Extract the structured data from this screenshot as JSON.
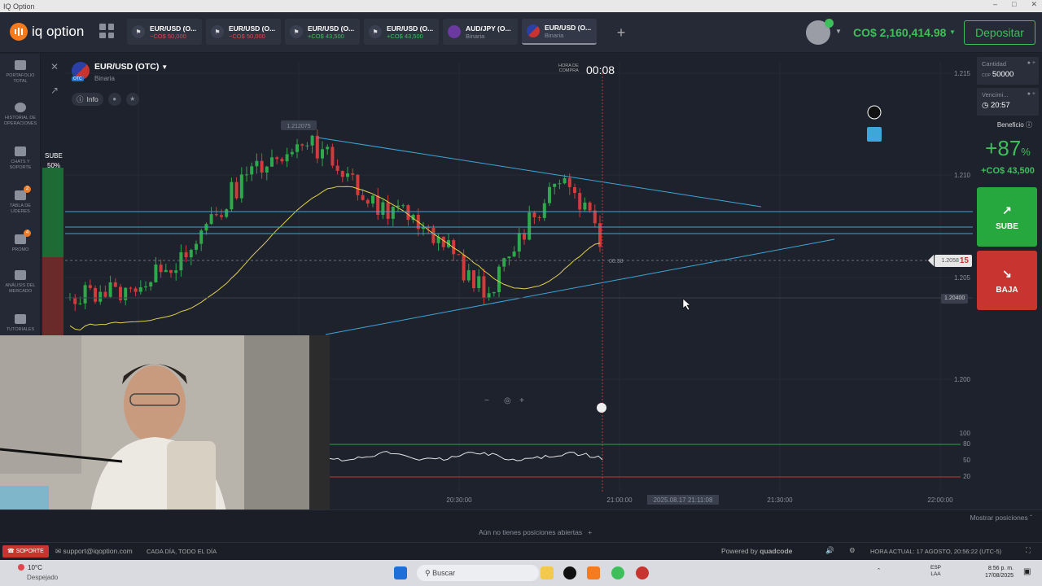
{
  "window": {
    "title": "IQ Option"
  },
  "topbar": {
    "logo_text": "iq option",
    "tabs": [
      {
        "pair": "EUR/USD (O...",
        "sub": "−CO$ 50,000",
        "sub_type": "neg"
      },
      {
        "pair": "EUR/USD (O...",
        "sub": "−CO$ 50,000",
        "sub_type": "neg"
      },
      {
        "pair": "EUR/USD (O...",
        "sub": "+CO$ 43,500",
        "sub_type": "pos"
      },
      {
        "pair": "EUR/USD (O...",
        "sub": "+CO$ 43,500",
        "sub_type": "pos"
      },
      {
        "pair": "AUD/JPY (O...",
        "sub": "Binaria",
        "sub_type": "mut"
      },
      {
        "pair": "EUR/USD (O...",
        "sub": "Binaria",
        "sub_type": "mut"
      }
    ],
    "add_tab": "+",
    "balance": "CO$ 2,160,414.98",
    "deposit_label": "Depositar"
  },
  "sidebar": {
    "items": [
      {
        "label": "PORTAFOLIO TOTAL"
      },
      {
        "label": "HISTORIAL DE OPERACIONES"
      },
      {
        "label": "CHATS Y SOPORTE"
      },
      {
        "label": "TABLA DE LÍDERES",
        "badge": "2"
      },
      {
        "label": "PROMO",
        "badge": "4"
      },
      {
        "label": "ANÁLISIS DEL MERCADO"
      },
      {
        "label": "TUTORIALES"
      }
    ]
  },
  "asset": {
    "name": "EUR/USD (OTC)",
    "type": "Binaria",
    "otc_badge": "OTC",
    "info_label": "Info"
  },
  "timer": {
    "hora_label_1": "HORA DE",
    "hora_label_2": "COMPRA",
    "value": "00:08"
  },
  "sentiment": {
    "label": "SUBE",
    "value": "50%"
  },
  "chart": {
    "price_labels": [
      "1.215",
      "1.210",
      "1.205",
      "1.200"
    ],
    "oscillator_labels": [
      "100",
      "80",
      "50",
      "20"
    ],
    "time_labels": [
      "20:30:00",
      "21:00:00",
      "21:30:00",
      "22:00:00"
    ],
    "cursor_time": "2025.08.17 21:11:08",
    "high_label": "1.212075",
    "countdown_label": "00:38",
    "current_price_prefix": "1.2058",
    "current_price_suffix": "15",
    "alert_price": "1.20400",
    "zoom_minus": "−",
    "zoom_plus": "+"
  },
  "right_panel": {
    "amount_label": "Cantidad",
    "amount_currency": "COP",
    "amount_value": "50000",
    "expiry_label": "Vencimi...",
    "expiry_value": "20:57",
    "profit_label": "Beneficio",
    "profit_pct": "+87",
    "profit_pct_sign": "%",
    "profit_amount": "+CO$ 43,500",
    "up_label": "SUBE",
    "down_label": "BAJA"
  },
  "bottom": {
    "no_positions": "Aún no tienes posiciones abiertas",
    "show_positions": "Mostrar posiciones"
  },
  "footer": {
    "support_btn": "SOPORTE",
    "email": "support@iqoption.com",
    "hours": "CADA DÍA, TODO EL DÍA",
    "powered": "Powered by",
    "powered_brand": "quadcode",
    "current_time": "HORA ACTUAL: 17 AGOSTO, 20:56:22 (UTC-5)"
  },
  "taskbar": {
    "weather_temp": "10°C",
    "weather_desc": "Despejado",
    "search_placeholder": "Buscar",
    "lang_1": "ESP",
    "lang_2": "LAA",
    "clock_time": "8:56 p. m.",
    "clock_date": "17/08/2025"
  },
  "colors": {
    "up": "#27a83e",
    "down": "#c8342f",
    "accent": "#f47b20",
    "balance": "#3fbf5c"
  }
}
